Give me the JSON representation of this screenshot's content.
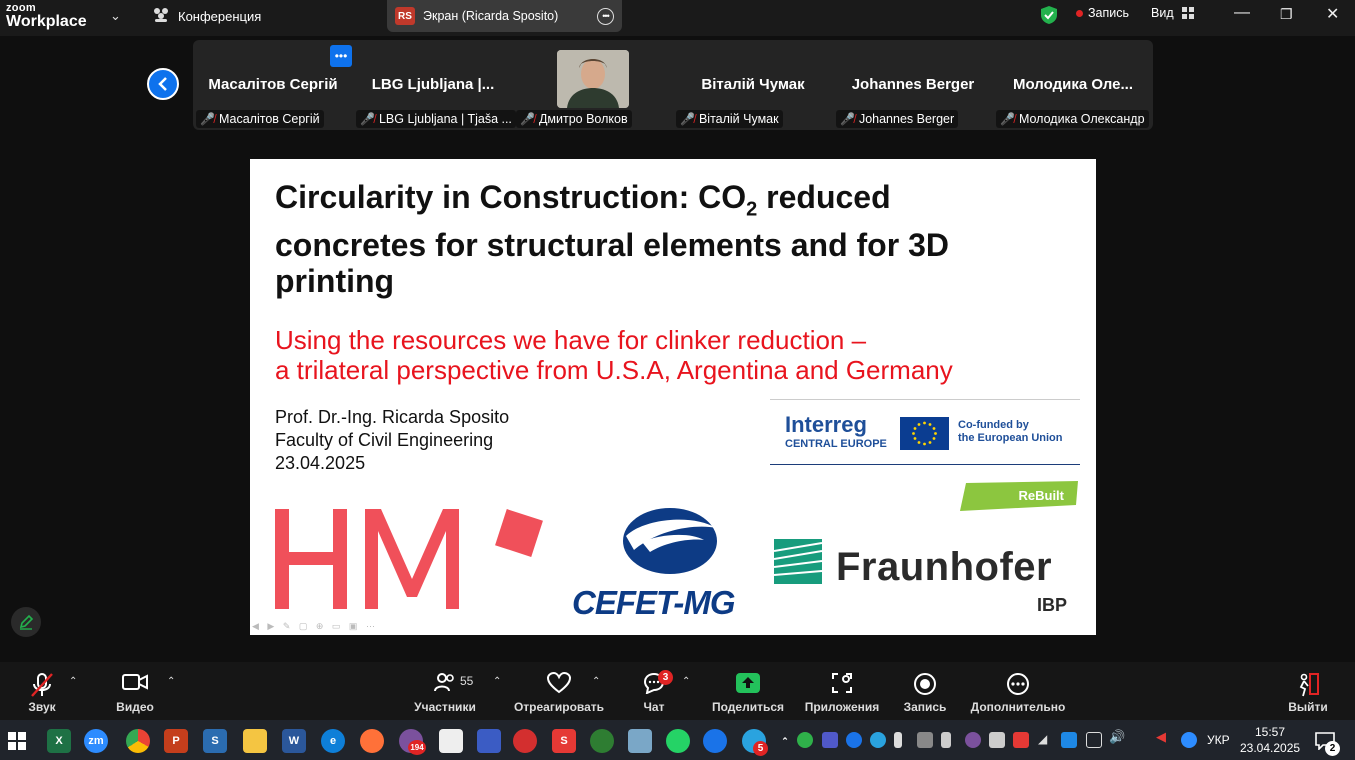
{
  "app": {
    "brand_top": "zoom",
    "brand_bottom": "Workplace",
    "meeting_menu": "Конференция"
  },
  "screen_share": {
    "initials": "RS",
    "label": "Экран (Ricarda Sposito)"
  },
  "top_right": {
    "record_label": "Запись",
    "view_label": "Вид"
  },
  "participants": [
    {
      "name": "Масалітов Сергій",
      "label": "Масалітов Сергій"
    },
    {
      "name": "LBG Ljubljana |...",
      "label": "LBG Ljubljana | Tjaša ..."
    },
    {
      "name": "",
      "label": "Дмитро Волков"
    },
    {
      "name": "Віталій Чумак",
      "label": "Віталій Чумак"
    },
    {
      "name": "Johannes Berger",
      "label": "Johannes Berger"
    },
    {
      "name": "Молодика  Оле...",
      "label": "Молодика Олександр"
    }
  ],
  "slide": {
    "title_part1": "Circularity in Construction: CO",
    "title_sub": "2",
    "title_part2": " reduced concretes for structural elements and for 3D printing",
    "subtitle_line1": "Using the resources we have for clinker reduction –",
    "subtitle_line2": "a trilateral perspective from U.S.A, Argentina and Germany",
    "author": "Prof. Dr.-Ing. Ricarda Sposito",
    "faculty": "Faculty of Civil Engineering",
    "date": "23.04.2025",
    "interreg": "Interreg",
    "central_europe": "CENTRAL EUROPE",
    "cofunded_line1": "Co-funded by",
    "cofunded_line2": "the European Union",
    "rebuilt": "ReBuilt",
    "hm": "HM",
    "cefet": "CEFET-MG",
    "fraunhofer": "Fraunhofer",
    "ibp": "IBP",
    "colors": {
      "red": "#e8141e",
      "hm_red": "#f0505a",
      "blue": "#1f4f99",
      "green": "#8cc63f"
    }
  },
  "toolbar": {
    "sound": "Звук",
    "video": "Видео",
    "participants": "Участники",
    "participants_count": "55",
    "react": "Отреагировать",
    "chat": "Чат",
    "chat_badge": "3",
    "share": "Поделиться",
    "apps": "Приложения",
    "record": "Запись",
    "more": "Дополнительно",
    "leave": "Выйти"
  },
  "taskbar": {
    "viber_badge": "194",
    "telegram_badge": "5",
    "lang": "УКР",
    "time": "15:57",
    "date": "23.04.2025",
    "notif_count": "2"
  }
}
